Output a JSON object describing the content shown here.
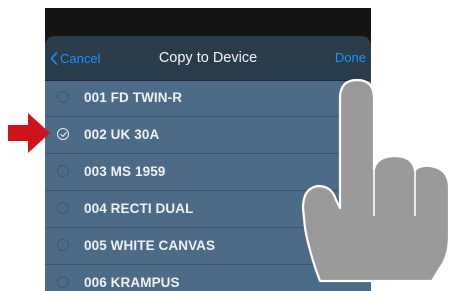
{
  "nav": {
    "cancel_label": "Cancel",
    "title": "Copy to Device",
    "done_label": "Done"
  },
  "devices": [
    {
      "label": "001 FD TWIN-R",
      "selected": false
    },
    {
      "label": "002 UK 30A",
      "selected": true
    },
    {
      "label": "003 MS 1959",
      "selected": false
    },
    {
      "label": "004 RECTI DUAL",
      "selected": false
    },
    {
      "label": "005 WHITE CANVAS",
      "selected": false
    },
    {
      "label": "006 KRAMPUS",
      "selected": false
    }
  ],
  "colors": {
    "accent": "#1e90ff",
    "list_background": "#4c6b86",
    "nav_background": "#2a3b4a",
    "pointer_arrow": "#d0141c",
    "hand": "#9a9a9a"
  },
  "icons": {
    "back": "chevron-left-icon",
    "check": "checkmark-circle-icon",
    "pointer": "red-arrow-icon",
    "hand": "pointing-hand-icon"
  }
}
